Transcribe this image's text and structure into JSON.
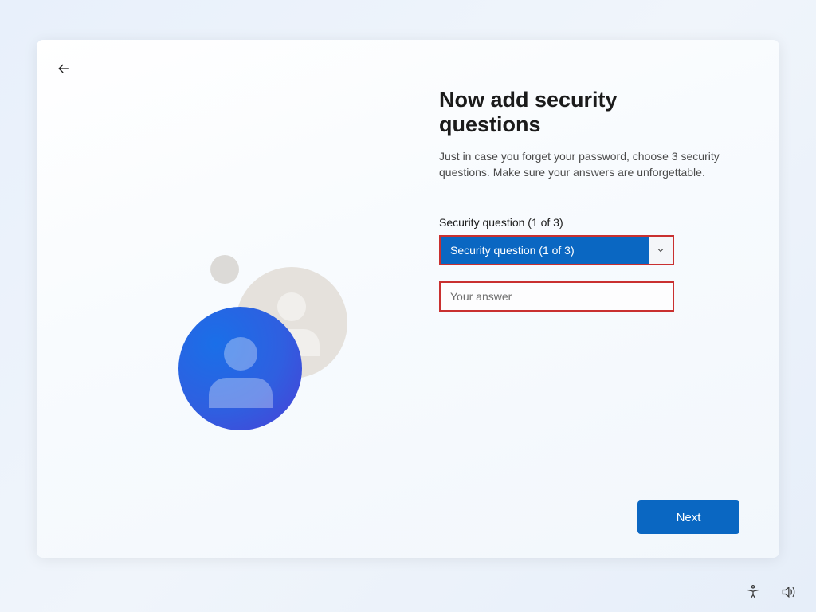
{
  "header": {
    "title": "Now add security questions",
    "subtitle": "Just in case you forget your password, choose 3 security questions. Make sure your answers are unforgettable."
  },
  "form": {
    "question_label": "Security question (1 of 3)",
    "question_selected": "Security question (1 of 3)",
    "answer_placeholder": "Your answer",
    "answer_value": ""
  },
  "actions": {
    "next": "Next"
  }
}
